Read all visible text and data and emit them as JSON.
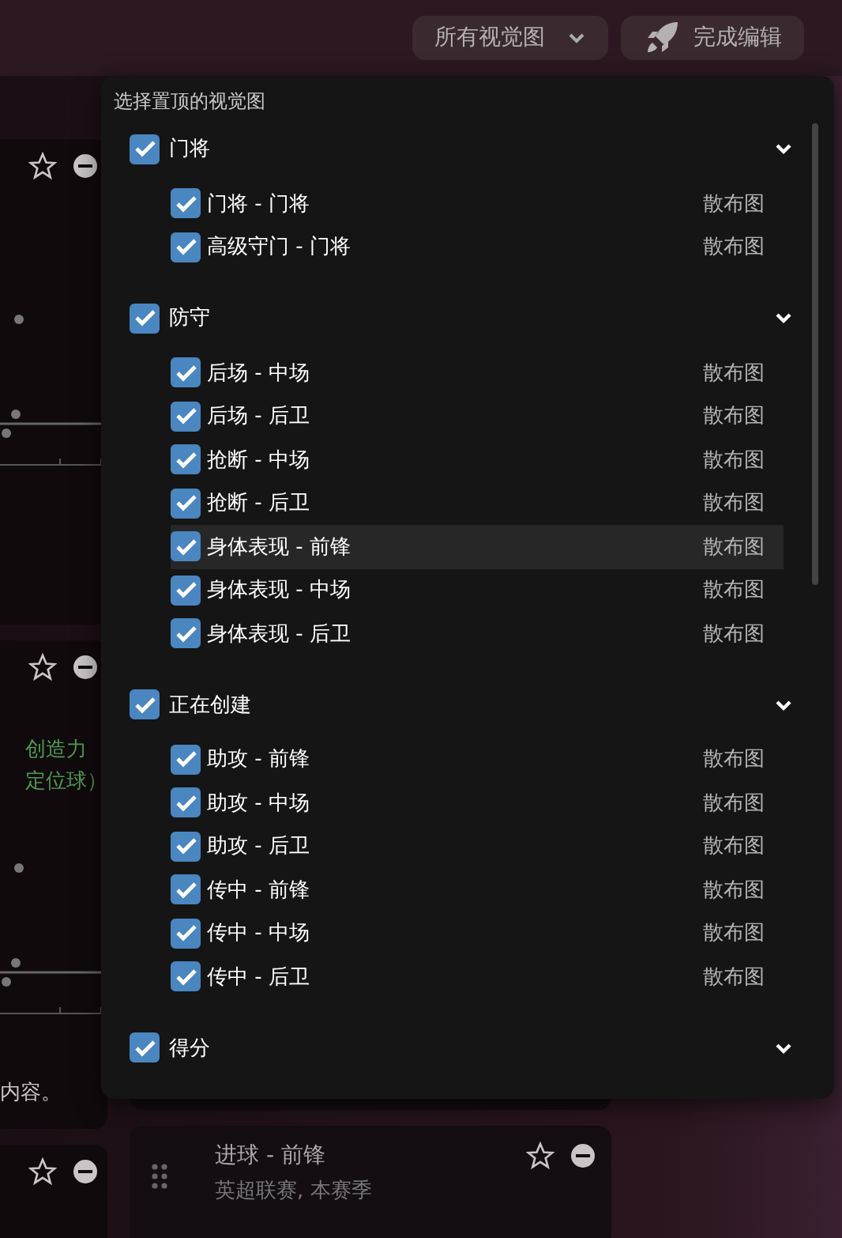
{
  "toolbar": {
    "view_filter": "所有视觉图",
    "done_button": "完成编辑"
  },
  "left_cards": [
    {
      "starred": false
    },
    {
      "starred": false,
      "lines": [
        "创造力",
        "定位球）"
      ],
      "footer": "内容。"
    },
    {
      "starred": false
    }
  ],
  "bottom_card": {
    "starred": false,
    "title": "进球 - 前锋",
    "subtitle": "英超联赛, 本赛季"
  },
  "panel": {
    "title": "选择置顶的视觉图",
    "groups": [
      {
        "label": "门将",
        "checked": true,
        "expanded": true,
        "items": [
          {
            "label": "门将 - 门将",
            "type": "散布图",
            "checked": true,
            "highlighted": false
          },
          {
            "label": "高级守门 - 门将",
            "type": "散布图",
            "checked": true,
            "highlighted": false
          }
        ]
      },
      {
        "label": "防守",
        "checked": true,
        "expanded": true,
        "items": [
          {
            "label": "后场 - 中场",
            "type": "散布图",
            "checked": true,
            "highlighted": false
          },
          {
            "label": "后场 - 后卫",
            "type": "散布图",
            "checked": true,
            "highlighted": false
          },
          {
            "label": "抢断 - 中场",
            "type": "散布图",
            "checked": true,
            "highlighted": false
          },
          {
            "label": "抢断 - 后卫",
            "type": "散布图",
            "checked": true,
            "highlighted": false
          },
          {
            "label": "身体表现 - 前锋",
            "type": "散布图",
            "checked": true,
            "highlighted": true
          },
          {
            "label": "身体表现 - 中场",
            "type": "散布图",
            "checked": true,
            "highlighted": false
          },
          {
            "label": "身体表现 - 后卫",
            "type": "散布图",
            "checked": true,
            "highlighted": false
          }
        ]
      },
      {
        "label": "正在创建",
        "checked": true,
        "expanded": true,
        "items": [
          {
            "label": "助攻 - 前锋",
            "type": "散布图",
            "checked": true,
            "highlighted": false
          },
          {
            "label": "助攻 - 中场",
            "type": "散布图",
            "checked": true,
            "highlighted": false
          },
          {
            "label": "助攻 - 后卫",
            "type": "散布图",
            "checked": true,
            "highlighted": false
          },
          {
            "label": "传中 - 前锋",
            "type": "散布图",
            "checked": true,
            "highlighted": false
          },
          {
            "label": "传中 - 中场",
            "type": "散布图",
            "checked": true,
            "highlighted": false
          },
          {
            "label": "传中 - 后卫",
            "type": "散布图",
            "checked": true,
            "highlighted": false
          }
        ]
      },
      {
        "label": "得分",
        "checked": true,
        "expanded": true
      }
    ]
  }
}
